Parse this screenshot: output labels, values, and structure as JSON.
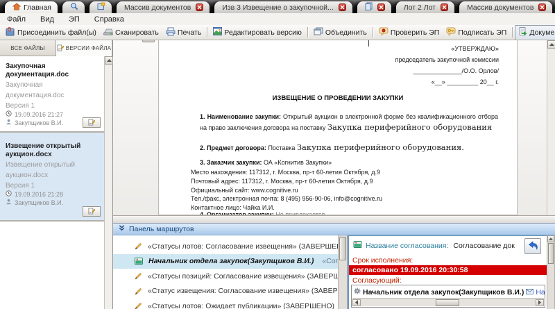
{
  "window_tabs": [
    {
      "label": "Главная",
      "icon": "home",
      "active": true,
      "closable": false
    },
    {
      "label": "",
      "icon": "search",
      "active": false,
      "closable": false
    },
    {
      "label": "",
      "icon": "new-window",
      "active": false,
      "closable": false
    },
    {
      "label": "Массив документов",
      "icon": "",
      "active": false,
      "closable": true
    },
    {
      "label": "Изв 3 Извещение о закупочной...",
      "icon": "",
      "active": false,
      "closable": true
    },
    {
      "label": "",
      "icon": "document",
      "active": false,
      "closable": true
    },
    {
      "label": "Лот 2 Лот",
      "icon": "",
      "active": false,
      "closable": true
    },
    {
      "label": "Массив документов",
      "icon": "",
      "active": false,
      "closable": true
    }
  ],
  "menu": {
    "items": [
      {
        "label": "Файл"
      },
      {
        "label": "Вид"
      },
      {
        "label": "ЭП"
      },
      {
        "label": "Справка"
      }
    ]
  },
  "toolbar": {
    "attach_label": "Присоединить файл(ы)",
    "scan_label": "Сканировать",
    "print_label": "Печать",
    "edit_version_label": "Редактировать версию",
    "merge_label": "Объединить",
    "verify_sig_label": "Проверить ЭП",
    "sign_label": "Подписать ЭП",
    "document_label": "Документ"
  },
  "sidebar": {
    "tab_all_files": "ВСЕ ФАЙЛЫ",
    "tab_file_versions": "ВЕРСИИ ФАЙЛА",
    "files": [
      {
        "title": "Закупочная документация.doc",
        "subtitle": "Закупочная документация.doc",
        "version": "Версия 1",
        "date": "19.09.2016 21:27",
        "author": "Закупщиков В.И.",
        "selected": false
      },
      {
        "title": "Извещение открытый аукцион.docx",
        "subtitle": "Извещение открытый аукцион.docx",
        "version": "Версия 1",
        "date": "19.09.2016 21:28",
        "author": "Закупщиков В.И.",
        "selected": true
      }
    ]
  },
  "document": {
    "approve_lines": [
      "«УТВЕРЖДАЮ»",
      "председатель закупочной комиссии",
      "______________/О.О. Орлов/",
      "«__» _________ 20__ г."
    ],
    "title": "ИЗВЕЩЕНИЕ О ПРОВЕДЕНИИ ЗАКУПКИ",
    "items": [
      {
        "num": "1.",
        "label": "Наименование закупки:",
        "text": "Открытый аукцион в электронной форме без квалификационного отбора на право заключения договора на поставку",
        "emphasis": "Закупка периферийного оборудования"
      },
      {
        "num": "2.",
        "label": "Предмет договора:",
        "text": "Поставка",
        "emphasis": "Закупка периферийного оборудования."
      },
      {
        "num": "3.",
        "label": "Заказчик закупки:",
        "text": "ОА «Когнитив Закупки»",
        "emphasis": ""
      },
      {
        "num": "4.",
        "label": "Организатор закупки:",
        "text": "Не привлекается",
        "emphasis": ""
      }
    ],
    "customer_lines": [
      "Место нахождения: 117312, г. Москва, пр-т 60-летия Октября, д.9",
      "Почтовый адрес: 117312, г. Москва, пр-т 60-летия Октября, д.9",
      "Официальный сайт: www.cognitive.ru",
      "Тел./факс, электронная почта: 8 (495) 956-90-06, info@cognitive.ru",
      "Контактное лицо: Чайка И.И."
    ]
  },
  "routes_panel": {
    "header": "Панель маршрутов",
    "items": [
      {
        "icon": "pencil",
        "text": "«Статусы лотов: Согласование извещения» (ЗАВЕРШЕНО)",
        "selected": false
      },
      {
        "icon": "stage",
        "bold": "Начальник отдела закупок(Закупщиков В.И.)",
        "rest": "«Согласование",
        "selected": true
      },
      {
        "icon": "pencil",
        "text": "«Статусы позиций: Согласование извещения» (ЗАВЕРШЕНО)",
        "selected": false
      },
      {
        "icon": "pencil",
        "text": "«Статус извещения: Согласование извещения» (ЗАВЕРШЕНО)",
        "selected": false
      },
      {
        "icon": "pencil",
        "text": "«Статусы лотов: Ожидает публикации» (ЗАВЕРШЕНО)",
        "selected": false
      }
    ]
  },
  "approval_panel": {
    "name_label": "Название согласования:",
    "name_value": "Согласование док",
    "deadline_label": "Срок исполнения:",
    "status_text": "согласовано 19.09.2016 20:30:58",
    "approver_label": "Согласующий:",
    "approver_name": "Начальник отдела закупок(Закупщиков В.И.)",
    "write_link": "Написать"
  },
  "icons": {
    "tab_close": "red-x",
    "home": "orange-house",
    "route_item": "pencil",
    "route_selected": "green-stage",
    "file_date": "clock",
    "file_author": "person",
    "file_action": "signature-pen",
    "panel_collapse": "double-chevron-down",
    "reply": "blue-reply-arrow",
    "approver": "gear",
    "write": "envelope"
  },
  "colors": {
    "tab_close_red": "#b02a20",
    "file_selection_blue": "#d9e7f5",
    "route_selection_blue": "#cfe7f2",
    "routes_header_top": "#ddecfc",
    "routes_header_bottom": "#a9c8e9",
    "status_bar_red": "#d40000",
    "label_teal": "#2b7d9b",
    "label_red": "#c32200",
    "link_blue": "#3355bb",
    "nav_arrow_green": "#52b85e"
  }
}
